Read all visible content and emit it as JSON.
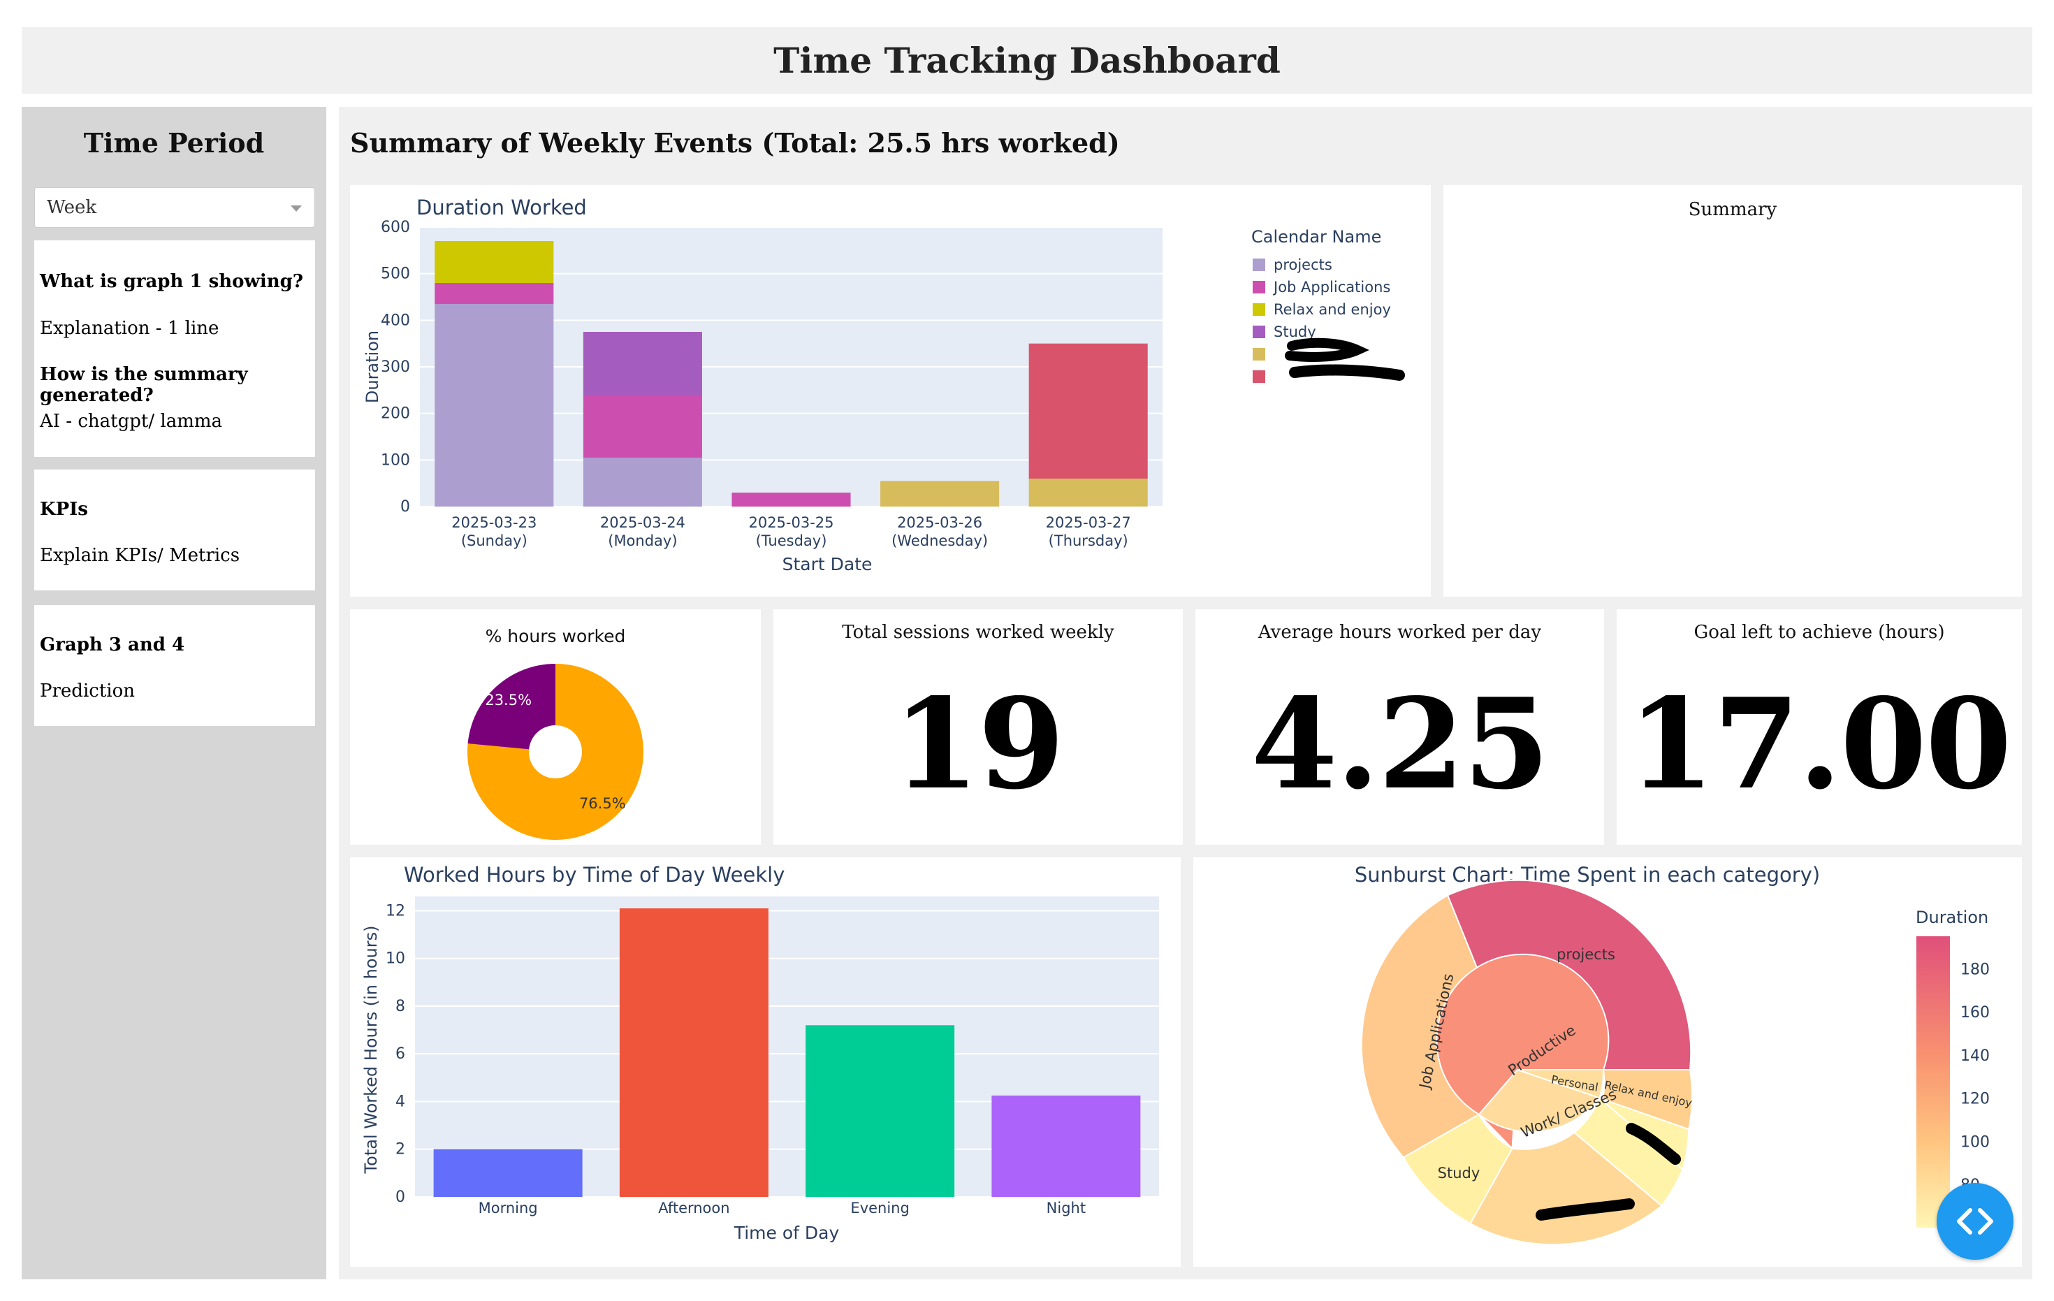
{
  "header": {
    "title": "Time Tracking Dashboard"
  },
  "sidebar": {
    "title": "Time Period",
    "period_select": {
      "value": "Week"
    },
    "info1": {
      "q1": "What is graph 1 showing?",
      "a1": "Explanation - 1 line",
      "q2": "How is the summary generated?",
      "a2": "AI - chatgpt/ lamma"
    },
    "info2": {
      "q": "KPIs",
      "a": "Explain KPIs/ Metrics"
    },
    "info3": {
      "q": "Graph 3 and 4",
      "a": "Prediction"
    }
  },
  "main": {
    "title": "Summary of Weekly Events (Total: 25.5 hrs worked)",
    "summary_panel_title": "Summary",
    "kpis": {
      "sessions": {
        "label": "Total sessions worked weekly",
        "value": "19"
      },
      "avg_hours": {
        "label": "Average hours worked per day",
        "value": "4.25"
      },
      "goal_left": {
        "label": "Goal left to achieve (hours)",
        "value": "17.00"
      }
    }
  },
  "colors": {
    "projects": "#ad9ed0",
    "job_applications": "#cc4fb0",
    "relax": "#cdc800",
    "study": "#a55cbf",
    "cat5": "#d7bc5c",
    "cat6": "#d9546b",
    "plot_bg": "#e5ecf6",
    "fab": "#1e9af0"
  },
  "chart_data": [
    {
      "type": "bar",
      "title": "Duration Worked",
      "xlabel": "Start Date",
      "ylabel": "Duration",
      "ylim": [
        0,
        600
      ],
      "yticks": [
        0,
        100,
        200,
        300,
        400,
        500,
        600
      ],
      "categories": [
        "2025-03-23",
        "2025-03-24",
        "2025-03-25",
        "2025-03-26",
        "2025-03-27"
      ],
      "category_sublabels": [
        "(Sunday)",
        "(Monday)",
        "(Tuesday)",
        "(Wednesday)",
        "(Thursday)"
      ],
      "legend_title": "Calendar Name",
      "series": [
        {
          "name": "projects",
          "color": "#ad9ed0",
          "values": [
            435,
            105,
            0,
            0,
            0
          ]
        },
        {
          "name": "Job Applications",
          "color": "#cc4fb0",
          "values": [
            45,
            135,
            30,
            0,
            0
          ]
        },
        {
          "name": "Relax and enjoy",
          "color": "#cdc800",
          "values": [
            90,
            0,
            0,
            0,
            0
          ]
        },
        {
          "name": "Study",
          "color": "#a55cbf",
          "values": [
            0,
            135,
            0,
            0,
            0
          ]
        },
        {
          "name": "",
          "color": "#d7bc5c",
          "values": [
            0,
            0,
            0,
            55,
            60
          ]
        },
        {
          "name": "",
          "color": "#d9546b",
          "values": [
            0,
            0,
            0,
            0,
            290
          ]
        }
      ]
    },
    {
      "type": "pie",
      "title": "% hours worked",
      "slices": [
        {
          "value": 76.5,
          "label": "76.5%",
          "color": "#ffa600"
        },
        {
          "value": 23.5,
          "label": "23.5%",
          "color": "#7a007a"
        }
      ]
    },
    {
      "type": "bar",
      "title": "Worked Hours by Time of Day Weekly",
      "xlabel": "Time of Day",
      "ylabel": "Total Worked Hours (in hours)",
      "ylim": [
        0,
        12.6
      ],
      "yticks": [
        0,
        2,
        4,
        6,
        8,
        10,
        12
      ],
      "categories": [
        "Morning",
        "Afternoon",
        "Evening",
        "Night"
      ],
      "values": [
        2,
        12.1,
        7.2,
        4.25
      ],
      "colors": [
        "#636efa",
        "#ef553b",
        "#00cc96",
        "#ab63fa"
      ]
    },
    {
      "type": "sunburst",
      "title": "Sunburst Chart: Time Spent in each category)",
      "colorbar_title": "Duration",
      "colorbar_range": [
        60,
        195
      ],
      "colorbar_ticks": [
        80,
        100,
        120,
        140,
        160,
        180
      ],
      "labels": [
        "Productive",
        "Work/ Classes",
        "Personal",
        "projects",
        "Job Applications",
        "Study",
        "Relax and enjoy"
      ]
    }
  ]
}
